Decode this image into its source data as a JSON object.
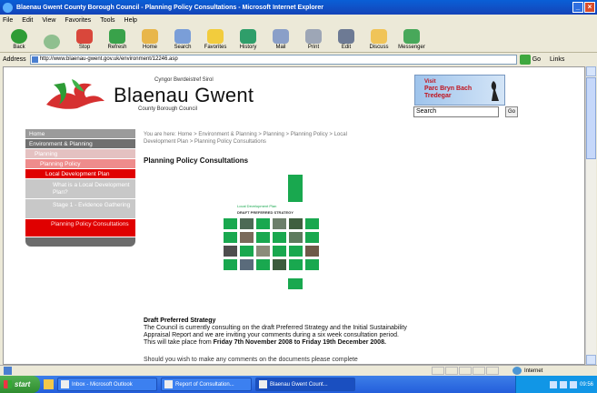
{
  "window": {
    "title": "Blaenau Gwent County Borough Council - Planning Policy Consultations - Microsoft Internet Explorer",
    "controls": [
      "_",
      "×"
    ]
  },
  "menu": [
    "File",
    "Edit",
    "View",
    "Favorites",
    "Tools",
    "Help"
  ],
  "toolbar": [
    {
      "label": "Back",
      "icon": "back-arrow-icon",
      "color": "#2e9c36"
    },
    {
      "label": "",
      "icon": "forward-arrow-icon",
      "color": "#8fbf8f"
    },
    {
      "label": "Stop",
      "icon": "stop-icon",
      "color": "#d9473b"
    },
    {
      "label": "Refresh",
      "icon": "refresh-icon",
      "color": "#39a24a"
    },
    {
      "label": "Home",
      "icon": "home-icon",
      "color": "#e8b64b"
    },
    {
      "label": "Search",
      "icon": "search-icon",
      "color": "#7a9ed8"
    },
    {
      "label": "Favorites",
      "icon": "favorites-star-icon",
      "color": "#f2cc3d"
    },
    {
      "label": "History",
      "icon": "history-icon",
      "color": "#2f9e6a"
    },
    {
      "label": "Mail",
      "icon": "mail-icon",
      "color": "#8a9fc8"
    },
    {
      "label": "Print",
      "icon": "print-icon",
      "color": "#9da6b6"
    },
    {
      "label": "Edit",
      "icon": "edit-icon",
      "color": "#6d7a94"
    },
    {
      "label": "Discuss",
      "icon": "discuss-icon",
      "color": "#f0c458"
    },
    {
      "label": "Messenger",
      "icon": "messenger-icon",
      "color": "#48a85a"
    }
  ],
  "address": {
    "label": "Address",
    "url": "http://www.blaenau-gwent.gov.uk/environment/12246.asp",
    "go_label": "Go",
    "links_label": "Links"
  },
  "site": {
    "welsh_name": "Cyngor Bwrdeistref Sirol",
    "council_name": "Blaenau Gwent",
    "council_sub": "County Borough Council",
    "banner": {
      "visit": "Visit",
      "title": "Parc Bryn Bach",
      "sub": "Tredegar"
    },
    "search_value": "Search",
    "search_button": "Go"
  },
  "nav": {
    "home": "Home",
    "environment": "Environment & Planning",
    "planning": "Planning",
    "planning_policy": "Planning Policy",
    "ldp": "Local Development Plan",
    "sub1": "What is a Local Development Plan?",
    "sub2": "Stage 1 - Evidence Gathering",
    "active": "Planning Policy Consultations"
  },
  "breadcrumb": "You are here: Home > Environment & Planning > Planning > Planning Policy > Local Development Plan > Planning Policy Consultations",
  "page_title": "Planning Policy Consultations",
  "doc": {
    "ldp_label": "Local Development Plan",
    "title": "DRAFT PREFERRED STRATEGY",
    "tile_colors": [
      "#19a84f",
      "#4d6a55",
      "#19a84f",
      "#6c7f6a",
      "#3f5f3f",
      "#19a84f",
      "#19a84f",
      "#7a6a5a",
      "#19a84f",
      "#19a84f",
      "#5d7b5d",
      "#19a84f",
      "#4e4e4e",
      "#19a84f",
      "#8b8c7a",
      "#19a84f",
      "#19a84f",
      "#6e5a48",
      "#19a84f",
      "#5a6b7b",
      "#19a84f",
      "#3c5c3c",
      "#19a84f",
      "#19a84f"
    ]
  },
  "content": {
    "heading": "Draft Preferred Strategy",
    "paragraph": "The Council is currently consulting on the draft Preferred Strategy and the Initial Sustainability Appraisal Report and we are inviting your comments during a six week consultation period. This will take place from",
    "dates": "Friday 7th November 2008 to Friday 19th December 2008.",
    "paragraph2": "Should you wish to make any comments on the documents please complete"
  },
  "statusbar": {
    "zone": "Internet"
  },
  "taskbar": {
    "start": "start",
    "items": [
      {
        "label": "Inbox - Microsoft Outlook",
        "active": false
      },
      {
        "label": "Report of Consultation...",
        "active": false
      },
      {
        "label": "Blaenau Gwent Count...",
        "active": true
      }
    ],
    "clock": "09:56"
  }
}
